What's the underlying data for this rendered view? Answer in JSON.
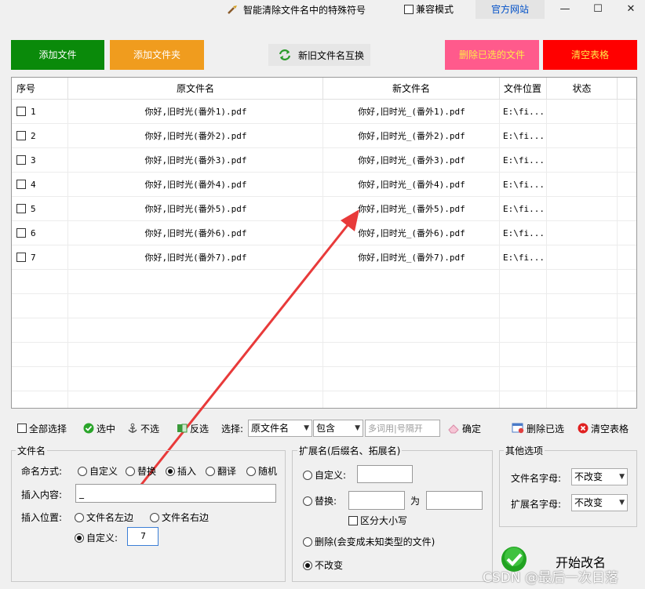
{
  "window": {
    "title": "智能清除文件名中的特殊符号",
    "compat_mode": "兼容模式",
    "official_site": "官方网站",
    "min": "—",
    "max": "☐",
    "close": "✕"
  },
  "toolbar": {
    "add_file": "添加文件",
    "add_folder": "添加文件夹",
    "swap_names": "新旧文件名互换",
    "delete_selected": "删除已选的文件",
    "clear_table": "清空表格"
  },
  "table": {
    "headers": [
      "序号",
      "原文件名",
      "新文件名",
      "文件位置",
      "状态"
    ],
    "rows": [
      {
        "no": "1",
        "old": "你好,旧时光(番外1).pdf",
        "new": "你好,旧时光_(番外1).pdf",
        "loc": "E:\\fi...",
        "status": ""
      },
      {
        "no": "2",
        "old": "你好,旧时光(番外2).pdf",
        "new": "你好,旧时光_(番外2).pdf",
        "loc": "E:\\fi...",
        "status": ""
      },
      {
        "no": "3",
        "old": "你好,旧时光(番外3).pdf",
        "new": "你好,旧时光_(番外3).pdf",
        "loc": "E:\\fi...",
        "status": ""
      },
      {
        "no": "4",
        "old": "你好,旧时光(番外4).pdf",
        "new": "你好,旧时光_(番外4).pdf",
        "loc": "E:\\fi...",
        "status": ""
      },
      {
        "no": "5",
        "old": "你好,旧时光(番外5).pdf",
        "new": "你好,旧时光_(番外5).pdf",
        "loc": "E:\\fi...",
        "status": ""
      },
      {
        "no": "6",
        "old": "你好,旧时光(番外6).pdf",
        "new": "你好,旧时光_(番外6).pdf",
        "loc": "E:\\fi...",
        "status": ""
      },
      {
        "no": "7",
        "old": "你好,旧时光(番外7).pdf",
        "new": "你好,旧时光_(番外7).pdf",
        "loc": "E:\\fi...",
        "status": ""
      }
    ]
  },
  "selbar": {
    "select_all": "全部选择",
    "check": "选中",
    "uncheck": "不选",
    "invert": "反选",
    "select_label": "选择:",
    "field_value": "原文件名",
    "match_value": "包含",
    "keyword_placeholder": "多词用|号隔开",
    "confirm": "确定",
    "delete_selected": "删除已选",
    "clear_table": "清空表格"
  },
  "filename_group": {
    "title": "文件名",
    "mode_label": "命名方式:",
    "modes": [
      "自定义",
      "替换",
      "插入",
      "翻译",
      "随机"
    ],
    "selected_mode": "插入",
    "insert_label": "插入内容:",
    "insert_value": "_",
    "position_label": "插入位置:",
    "positions": [
      "文件名左边",
      "文件名右边"
    ],
    "custom_label": "自定义:",
    "custom_value": "7"
  },
  "ext_group": {
    "title": "扩展名(后缀名、拓展名)",
    "custom": "自定义:",
    "replace": "替换:",
    "replace_for": "为",
    "case_sensitive": "区分大小写",
    "delete": "删除(会变成未知类型的文件)",
    "no_change": "不改变"
  },
  "other_group": {
    "title": "其他选项",
    "name_case_label": "文件名字母:",
    "name_case_value": "不改变",
    "ext_case_label": "扩展名字母:",
    "ext_case_value": "不改变"
  },
  "start": {
    "label": "开始改名"
  },
  "watermark": "CSDN @最后一次日落",
  "colors": {
    "green": "#0a8a0a",
    "orange": "#f09c1e",
    "pink": "#ff5a8c",
    "red": "#ff0000",
    "annotation": "#e83a3a",
    "link": "#0050c8"
  }
}
